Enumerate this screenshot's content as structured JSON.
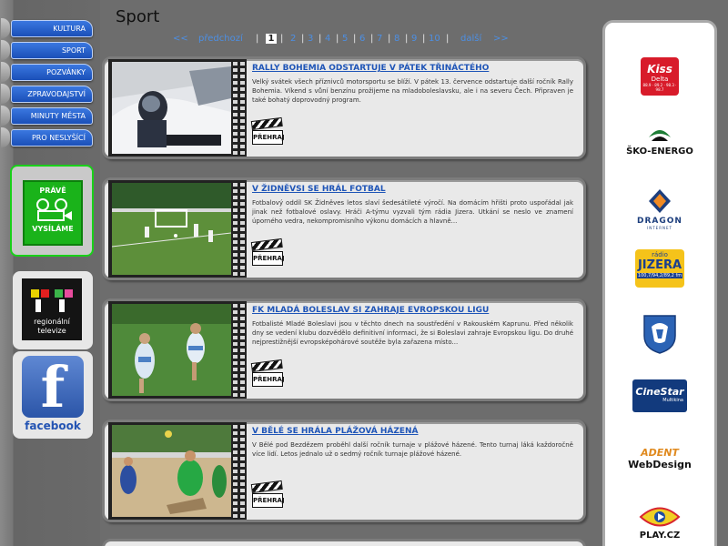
{
  "nav": {
    "items": [
      "KULTURA",
      "SPORT",
      "POZVÁNKY",
      "ZPRAVODAJSTVÍ",
      "MINUTY MĚSTA",
      "PRO NESLYŠÍCÍ"
    ],
    "accent": "#1f55c8"
  },
  "onair": {
    "line1": "PRÁVĚ",
    "line2": "VYSÍLÁME",
    "color": "#1ab31a"
  },
  "rtv": {
    "label_line1": "regionální",
    "label_line2": "televize"
  },
  "facebook": {
    "icon_letter": "f",
    "label": "facebook"
  },
  "page": {
    "title": "Sport"
  },
  "pager": {
    "prev_arrow": "<<",
    "prev_label": "předchozí",
    "divider": "|",
    "pages": [
      "1",
      "2",
      "3",
      "4",
      "5",
      "6",
      "7",
      "8",
      "9",
      "10"
    ],
    "current": "1",
    "next_label": "další",
    "next_arrow": ">>"
  },
  "articles": [
    {
      "title": "RALLY BOHEMIA ODSTARTUJE V PÁTEK TŘINÁCTÉHO",
      "body": "Velký svátek všech příznivců motorsportu se blíží. V pátek 13. července odstartuje další ročník Rally Bohemia. Víkend s vůní benzínu prožijeme na mladoboleslavsku, ale i na severu Čech. Připraven je také bohatý doprovodný program.",
      "play_label": "PŘEHRAJ"
    },
    {
      "title": "V ŽIDNĚVSI SE HRÁL FOTBAL",
      "body": "Fotbalový oddíl SK Židněves letos slaví šedesátileté výročí. Na domácím hřišti proto uspořádal jak jinak než fotbalové oslavy. Hráči A-týmu vyzvali tým rádia Jizera. Utkání se neslo ve znamení úporného vedra, nekompromisního výkonu domácích a hlavně...",
      "play_label": "PŘEHRAJ"
    },
    {
      "title": "FK MLADÁ BOLESLAV SI ZAHRAJE EVROPSKOU LIGU",
      "body": "Fotbalisté Mladé Boleslavi jsou v těchto dnech na soustředění v Rakouském Kaprunu. Před několik dny se vedení klubu dozvědělo definitivní informaci, že si Boleslavi zahraje Evropskou ligu. Do druhé nejprestižnější evropsképohárové soutěže byla zařazena místo...",
      "play_label": "PŘEHRAJ"
    },
    {
      "title": "V BĚLÉ SE HRÁLA PLÁŽOVÁ HÁZENÁ",
      "body": "V Bělé pod Bezdězem proběhl další ročník turnaje v plážové házené. Tento turnaj láká každoročně více lidí. Letos jednalo už o sedmý ročník turnaje plážové házené.",
      "play_label": "PŘEHRAJ"
    }
  ],
  "sponsors": {
    "kiss": {
      "name": "Kiss",
      "sub": "Delta",
      "freq": "88.9 · 89.2 · 98.3 · 98.7"
    },
    "skoenergo": {
      "name": "ŠKO-ENERGO"
    },
    "dragon": {
      "name": "DRAGON",
      "sub": "INTERNET"
    },
    "jizera": {
      "small": "rádio",
      "name": "JIZERA",
      "freq": "100,7/94,2/89,2 fm"
    },
    "cinestar": {
      "name": "CineStar",
      "sub": "Multikina"
    },
    "adent": {
      "name": "ADENT",
      "sub": "WebDesign"
    },
    "play": {
      "name": "PLAY.CZ"
    }
  }
}
